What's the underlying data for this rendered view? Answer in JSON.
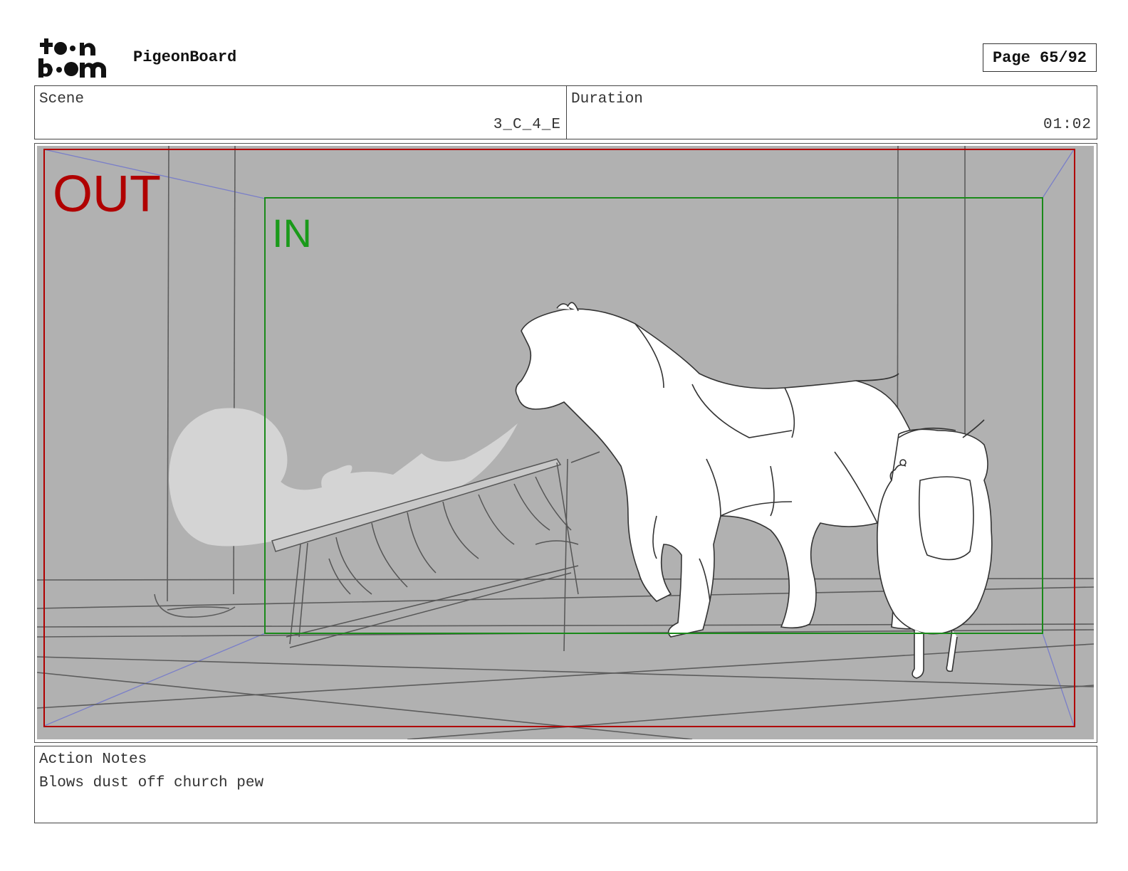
{
  "header": {
    "logo_text": "toon boom",
    "app_title": "PigeonBoard",
    "page_label": "Page 65/92"
  },
  "info": {
    "scene_label": "Scene",
    "scene_value": "3_C_4_E",
    "duration_label": "Duration",
    "duration_value": "01:02"
  },
  "panel": {
    "out_label": "OUT",
    "in_label": "IN",
    "colors": {
      "background": "#b1b1b1",
      "out_frame": "#b00000",
      "in_frame": "#1a8a1a",
      "perspective_line": "#7a7fc8",
      "sketch_line": "#555555",
      "dust": "#d4d4d4"
    }
  },
  "notes": {
    "label": "Action Notes",
    "text": "Blows dust off church pew"
  }
}
